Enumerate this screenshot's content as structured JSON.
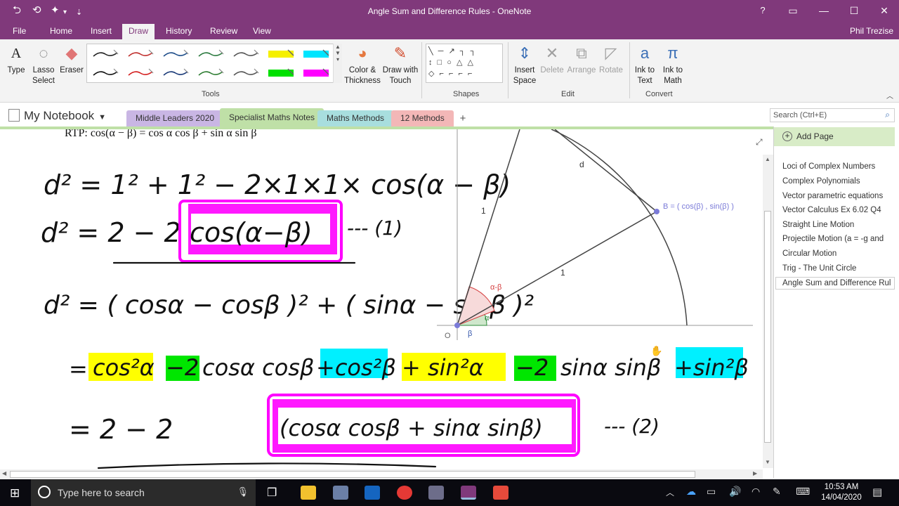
{
  "window": {
    "title": "Angle Sum and Difference Rules - OneNote",
    "help": "?",
    "controls": {
      "ribbon_display": "▭",
      "minimize": "—",
      "maximize": "☐",
      "close": "✕"
    }
  },
  "quick_access": {
    "back": "⮌",
    "undo": "⟲",
    "dock": "✦",
    "more": "▾",
    "customize": "⇣"
  },
  "ribbon_tabs": [
    "File",
    "Home",
    "Insert",
    "Draw",
    "History",
    "Review",
    "View"
  ],
  "active_tab": "Draw",
  "user": "Phil Trezise",
  "tools": {
    "type_label": "Type",
    "lasso_label": "Lasso Select",
    "eraser_label": "Eraser",
    "pen_colors_row1": [
      "#222222",
      "#c0302e",
      "#1f4e8a",
      "#2b7a3f",
      "#555555",
      "#f5f000",
      "#00e5ff"
    ],
    "pen_colors_row2": [
      "#111111",
      "#d41f1f",
      "#1a3a78",
      "#2e7d32",
      "#555555",
      "#00e000",
      "#ff00ff"
    ],
    "group_label": "Tools",
    "color_thickness_label": "Color & Thickness",
    "draw_touch_label": "Draw with Touch"
  },
  "shapes": {
    "group_label": "Shapes"
  },
  "edit": {
    "insert_space_label": "Insert Space",
    "delete_label": "Delete",
    "arrange_label": "Arrange",
    "rotate_label": "Rotate",
    "group_label": "Edit"
  },
  "convert": {
    "ink_text_label": "Ink to Text",
    "ink_math_label": "Ink to Math",
    "group_label": "Convert"
  },
  "notebook": {
    "name": "My Notebook",
    "sections": [
      {
        "label": "Middle Leaders 2020",
        "color": "#c9b6e4"
      },
      {
        "label": "Specialist Maths Notes",
        "color": "#bfe0a7"
      },
      {
        "label": "Maths Methods",
        "color": "#a8dede"
      },
      {
        "label": "12 Methods",
        "color": "#f3b7b7"
      }
    ],
    "add_section": "+"
  },
  "search": {
    "placeholder": "Search (Ctrl+E)"
  },
  "pages": {
    "add_label": "Add Page",
    "items": [
      "Loci of Complex Numbers",
      "Complex Polynomials",
      "Vector parametric equations",
      "Vector Calculus Ex 6.02 Q4",
      "Straight Line Motion",
      "Projectile Motion (a = -g and",
      "Circular Motion",
      "Trig - The Unit Circle",
      "Angle Sum and Difference Rul"
    ],
    "selected_index": 8
  },
  "note": {
    "rtp": "RTP: cos(α − β) = cos α cos β + sin α sin β",
    "line1": "d² = 1² + 1² − 2×1×1× cos(α − β)",
    "line2_left": "d² = 2 − 2",
    "line2_boxed": "cos(α−β)",
    "line2_tag": "--- (1)",
    "line3": "d² = ( cosα − cosβ )² + ( sinα − sinβ )²",
    "line4": [
      "=",
      "cos²α",
      "−2",
      "cosα cosβ",
      "+cos²β",
      "+ sin²α",
      "−2",
      "sinα sinβ",
      "+sin²β"
    ],
    "line5_left": "=  2   − 2",
    "line5_boxed": "(cosα cosβ + sinα sinβ)",
    "line5_tag": "--- (2)"
  },
  "diagram": {
    "point_b": "B = ( cos(β) , sin(β) )",
    "label_d": "d",
    "label_one_a": "1",
    "label_one_b": "1",
    "label_origin": "O",
    "angle_diff": "α-β",
    "angle_alpha": "α",
    "angle_beta": "β",
    "colors": {
      "diff_wedge": "#f7dada",
      "alpha_wedge": "#cfe7cc",
      "beta_wedge": "#cfdaf0",
      "point": "#7b7bd8"
    }
  },
  "highlights": {
    "yellow": "#ffff00",
    "green": "#00e600",
    "cyan": "#00f0ff",
    "magenta": "#ff00ff"
  },
  "taskbar": {
    "search_placeholder": "Type here to search",
    "time": "10:53 AM",
    "date": "14/04/2020"
  }
}
